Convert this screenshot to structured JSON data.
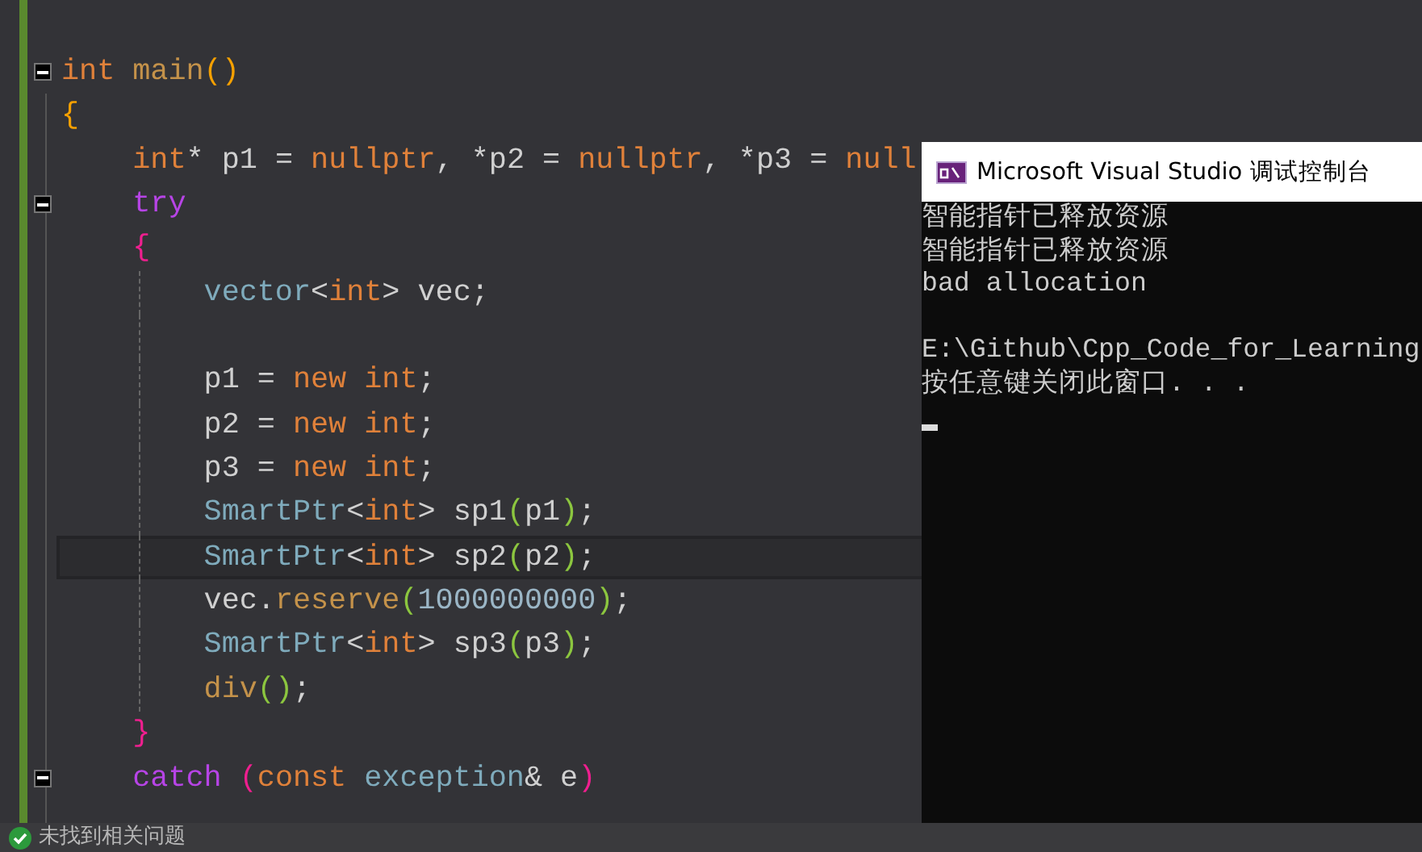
{
  "editor": {
    "lines": [
      {
        "collapsible": true,
        "highlighted": false,
        "tokens": [
          {
            "kind": "keyword",
            "text": "int"
          },
          {
            "kind": "function",
            "text": " main"
          },
          {
            "kind": "brace1",
            "text": "()"
          }
        ]
      },
      {
        "collapsible": false,
        "highlighted": false,
        "tokens": [
          {
            "kind": "brace1",
            "text": "{"
          }
        ]
      },
      {
        "collapsible": false,
        "highlighted": false,
        "tokens": [
          {
            "kind": "keyword",
            "text": "    int"
          },
          {
            "kind": "plain",
            "text": "* p1 = "
          },
          {
            "kind": "keyword",
            "text": "nullptr"
          },
          {
            "kind": "plain",
            "text": ", *p2 = "
          },
          {
            "kind": "keyword",
            "text": "nullptr"
          },
          {
            "kind": "plain",
            "text": ", *p3 = "
          },
          {
            "kind": "keyword",
            "text": "null"
          }
        ]
      },
      {
        "collapsible": true,
        "highlighted": false,
        "tokens": [
          {
            "kind": "control",
            "text": "    try"
          }
        ]
      },
      {
        "collapsible": false,
        "highlighted": false,
        "tokens": [
          {
            "kind": "brace2",
            "text": "    {"
          }
        ]
      },
      {
        "collapsible": false,
        "highlighted": false,
        "tokens": [
          {
            "kind": "type",
            "text": "        vector"
          },
          {
            "kind": "plain",
            "text": "<"
          },
          {
            "kind": "keyword",
            "text": "int"
          },
          {
            "kind": "plain",
            "text": "> vec;"
          }
        ]
      },
      {
        "collapsible": false,
        "highlighted": false
      },
      {
        "collapsible": false,
        "highlighted": false,
        "tokens": [
          {
            "kind": "plain",
            "text": "        p1 = "
          },
          {
            "kind": "keyword",
            "text": "new"
          },
          {
            "kind": "keyword",
            "text": " int"
          },
          {
            "kind": "plain",
            "text": ";"
          }
        ]
      },
      {
        "collapsible": false,
        "highlighted": false,
        "tokens": [
          {
            "kind": "plain",
            "text": "        p2 = "
          },
          {
            "kind": "keyword",
            "text": "new"
          },
          {
            "kind": "keyword",
            "text": " int"
          },
          {
            "kind": "plain",
            "text": ";"
          }
        ]
      },
      {
        "collapsible": false,
        "highlighted": false,
        "tokens": [
          {
            "kind": "plain",
            "text": "        p3 = "
          },
          {
            "kind": "keyword",
            "text": "new"
          },
          {
            "kind": "keyword",
            "text": " int"
          },
          {
            "kind": "plain",
            "text": ";"
          }
        ]
      },
      {
        "collapsible": false,
        "highlighted": false,
        "tokens": [
          {
            "kind": "type",
            "text": "        SmartPtr"
          },
          {
            "kind": "plain",
            "text": "<"
          },
          {
            "kind": "keyword",
            "text": "int"
          },
          {
            "kind": "plain",
            "text": "> sp1"
          },
          {
            "kind": "brace3",
            "text": "("
          },
          {
            "kind": "plain",
            "text": "p1"
          },
          {
            "kind": "brace3",
            "text": ")"
          },
          {
            "kind": "plain",
            "text": ";"
          }
        ]
      },
      {
        "collapsible": false,
        "highlighted": true,
        "tokens": [
          {
            "kind": "type",
            "text": "        SmartPtr"
          },
          {
            "kind": "plain",
            "text": "<"
          },
          {
            "kind": "keyword",
            "text": "int"
          },
          {
            "kind": "plain",
            "text": "> sp2"
          },
          {
            "kind": "brace3",
            "text": "("
          },
          {
            "kind": "plain",
            "text": "p2"
          },
          {
            "kind": "brace3",
            "text": ")"
          },
          {
            "kind": "plain",
            "text": ";"
          }
        ]
      },
      {
        "collapsible": false,
        "highlighted": false,
        "tokens": [
          {
            "kind": "plain",
            "text": "        vec."
          },
          {
            "kind": "function",
            "text": "reserve"
          },
          {
            "kind": "brace3",
            "text": "("
          },
          {
            "kind": "number",
            "text": "1000000000"
          },
          {
            "kind": "brace3",
            "text": ")"
          },
          {
            "kind": "plain",
            "text": ";"
          }
        ]
      },
      {
        "collapsible": false,
        "highlighted": false,
        "tokens": [
          {
            "kind": "type",
            "text": "        SmartPtr"
          },
          {
            "kind": "plain",
            "text": "<"
          },
          {
            "kind": "keyword",
            "text": "int"
          },
          {
            "kind": "plain",
            "text": "> sp3"
          },
          {
            "kind": "brace3",
            "text": "("
          },
          {
            "kind": "plain",
            "text": "p3"
          },
          {
            "kind": "brace3",
            "text": ")"
          },
          {
            "kind": "plain",
            "text": ";"
          }
        ]
      },
      {
        "collapsible": false,
        "highlighted": false,
        "tokens": [
          {
            "kind": "function",
            "text": "        div"
          },
          {
            "kind": "brace3",
            "text": "()"
          },
          {
            "kind": "plain",
            "text": ";"
          }
        ]
      },
      {
        "collapsible": false,
        "highlighted": false,
        "tokens": [
          {
            "kind": "brace2",
            "text": "    }"
          }
        ]
      },
      {
        "collapsible": true,
        "highlighted": false,
        "tokens": [
          {
            "kind": "control",
            "text": "    catch"
          },
          {
            "kind": "brace2",
            "text": " ("
          },
          {
            "kind": "keyword",
            "text": "const"
          },
          {
            "kind": "type",
            "text": " exception"
          },
          {
            "kind": "plain",
            "text": "& e"
          },
          {
            "kind": "brace2",
            "text": ")"
          }
        ]
      }
    ]
  },
  "console": {
    "title": "Microsoft Visual Studio 调试控制台",
    "output": [
      "智能指针已释放资源",
      "智能指针已释放资源",
      "bad allocation"
    ],
    "prompt": [
      "E:\\Github\\Cpp_Code_for_Learning",
      "按任意键关闭此窗口. . ."
    ]
  },
  "status_bar": {
    "message": "未找到相关问题"
  }
}
